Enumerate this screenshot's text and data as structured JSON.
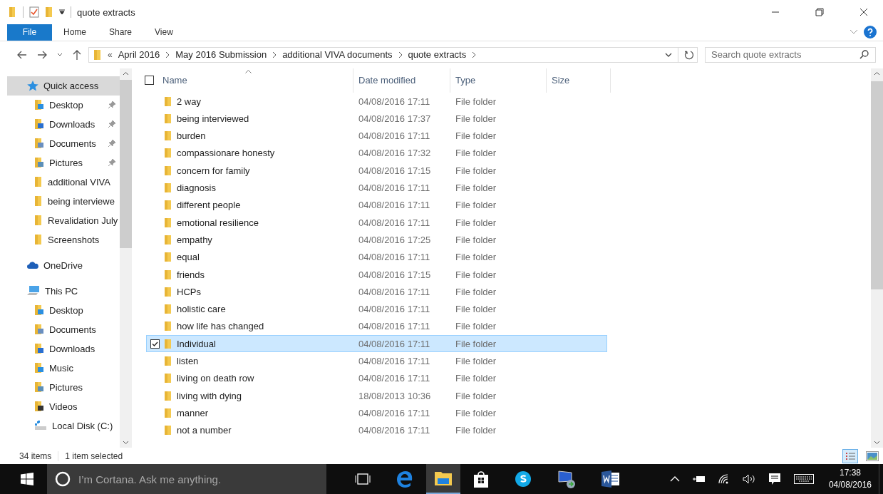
{
  "window": {
    "title": "quote extracts"
  },
  "ribbon_tabs": [
    {
      "label": "File",
      "selected": true
    },
    {
      "label": "Home",
      "selected": false
    },
    {
      "label": "Share",
      "selected": false
    },
    {
      "label": "View",
      "selected": false
    }
  ],
  "address_bar": {
    "overflow": "«",
    "crumbs": [
      "April 2016",
      "May 2016 Submission",
      "additional VIVA documents",
      "quote extracts"
    ]
  },
  "search": {
    "placeholder": "Search quote extracts"
  },
  "sidebar": {
    "items": [
      {
        "label": "Quick access",
        "kind": "star",
        "selected": true,
        "pinned": false
      },
      {
        "label": "Desktop",
        "kind": "desktop",
        "selected": false,
        "pinned": true
      },
      {
        "label": "Downloads",
        "kind": "downloads",
        "selected": false,
        "pinned": true
      },
      {
        "label": "Documents",
        "kind": "documents",
        "selected": false,
        "pinned": true
      },
      {
        "label": "Pictures",
        "kind": "pictures",
        "selected": false,
        "pinned": true
      },
      {
        "label": "additional VIVA",
        "kind": "folder",
        "selected": false,
        "pinned": false
      },
      {
        "label": "being interviewe",
        "kind": "folder",
        "selected": false,
        "pinned": false
      },
      {
        "label": "Revalidation July",
        "kind": "folder",
        "selected": false,
        "pinned": false
      },
      {
        "label": "Screenshots",
        "kind": "folder",
        "selected": false,
        "pinned": false
      },
      {
        "label": "OneDrive",
        "kind": "cloud",
        "selected": false,
        "pinned": false
      },
      {
        "label": "This PC",
        "kind": "pc",
        "selected": false,
        "pinned": false
      },
      {
        "label": "Desktop",
        "kind": "desktop",
        "selected": false,
        "pinned": false
      },
      {
        "label": "Documents",
        "kind": "documents",
        "selected": false,
        "pinned": false
      },
      {
        "label": "Downloads",
        "kind": "downloads",
        "selected": false,
        "pinned": false
      },
      {
        "label": "Music",
        "kind": "music",
        "selected": false,
        "pinned": false
      },
      {
        "label": "Pictures",
        "kind": "pictures",
        "selected": false,
        "pinned": false
      },
      {
        "label": "Videos",
        "kind": "videos",
        "selected": false,
        "pinned": false
      },
      {
        "label": "Local Disk (C:)",
        "kind": "drive",
        "selected": false,
        "pinned": false
      }
    ]
  },
  "table": {
    "select_all": {
      "checked": false
    },
    "columns": [
      "Name",
      "Date modified",
      "Type",
      "Size"
    ],
    "rows": [
      {
        "name": "2 way",
        "date": "04/08/2016 17:11",
        "type": "File folder",
        "selected": false
      },
      {
        "name": "being interviewed",
        "date": "04/08/2016 17:37",
        "type": "File folder",
        "selected": false
      },
      {
        "name": "burden",
        "date": "04/08/2016 17:11",
        "type": "File folder",
        "selected": false
      },
      {
        "name": "compassionare honesty",
        "date": "04/08/2016 17:32",
        "type": "File folder",
        "selected": false
      },
      {
        "name": "concern for family",
        "date": "04/08/2016 17:15",
        "type": "File folder",
        "selected": false
      },
      {
        "name": "diagnosis",
        "date": "04/08/2016 17:11",
        "type": "File folder",
        "selected": false
      },
      {
        "name": "different people",
        "date": "04/08/2016 17:11",
        "type": "File folder",
        "selected": false
      },
      {
        "name": "emotional resilience",
        "date": "04/08/2016 17:11",
        "type": "File folder",
        "selected": false
      },
      {
        "name": "empathy",
        "date": "04/08/2016 17:25",
        "type": "File folder",
        "selected": false
      },
      {
        "name": "equal",
        "date": "04/08/2016 17:11",
        "type": "File folder",
        "selected": false
      },
      {
        "name": "friends",
        "date": "04/08/2016 17:15",
        "type": "File folder",
        "selected": false
      },
      {
        "name": "HCPs",
        "date": "04/08/2016 17:11",
        "type": "File folder",
        "selected": false
      },
      {
        "name": "holistic care",
        "date": "04/08/2016 17:11",
        "type": "File folder",
        "selected": false
      },
      {
        "name": "how life has changed",
        "date": "04/08/2016 17:11",
        "type": "File folder",
        "selected": false
      },
      {
        "name": "Individual",
        "date": "04/08/2016 17:11",
        "type": "File folder",
        "selected": true
      },
      {
        "name": "listen",
        "date": "04/08/2016 17:11",
        "type": "File folder",
        "selected": false
      },
      {
        "name": "living on death row",
        "date": "04/08/2016 17:11",
        "type": "File folder",
        "selected": false
      },
      {
        "name": "living with dying",
        "date": "18/08/2013 10:36",
        "type": "File folder",
        "selected": false
      },
      {
        "name": "manner",
        "date": "04/08/2016 17:11",
        "type": "File folder",
        "selected": false
      },
      {
        "name": "not a number",
        "date": "04/08/2016 17:11",
        "type": "File folder",
        "selected": false
      }
    ]
  },
  "status_bar": {
    "count": "34 items",
    "selection": "1 item selected"
  },
  "taskbar": {
    "search_placeholder": "I’m Cortana. Ask me anything.",
    "time": "17:38",
    "date": "04/08/2016"
  }
}
